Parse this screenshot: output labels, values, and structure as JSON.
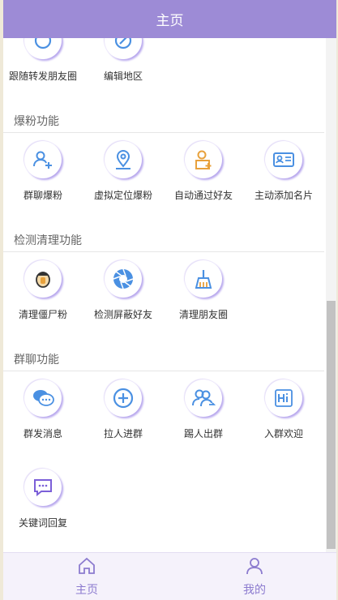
{
  "header": {
    "title": "主页"
  },
  "top_items": [
    {
      "label": "跟随转发朋友圈",
      "icon": "forward-icon"
    },
    {
      "label": "编辑地区",
      "icon": "edit-location-icon"
    }
  ],
  "sections": [
    {
      "title": "爆粉功能",
      "items": [
        {
          "label": "群聊爆粉",
          "icon": "group-add-icon"
        },
        {
          "label": "虚拟定位爆粉",
          "icon": "location-pin-icon"
        },
        {
          "label": "自动通过好友",
          "icon": "user-check-icon"
        },
        {
          "label": "主动添加名片",
          "icon": "card-icon"
        }
      ]
    },
    {
      "title": "检测清理功能",
      "items": [
        {
          "label": "清理僵尸粉",
          "icon": "zombie-icon"
        },
        {
          "label": "检测屏蔽好友",
          "icon": "shutter-icon"
        },
        {
          "label": "清理朋友圈",
          "icon": "broom-icon"
        }
      ]
    },
    {
      "title": "群聊功能",
      "items": [
        {
          "label": "群发消息",
          "icon": "chat-bubbles-icon"
        },
        {
          "label": "拉人进群",
          "icon": "plus-circle-icon"
        },
        {
          "label": "踢人出群",
          "icon": "user-remove-icon"
        },
        {
          "label": "入群欢迎",
          "icon": "hi-card-icon"
        },
        {
          "label": "关键词回复",
          "icon": "message-reply-icon"
        }
      ]
    }
  ],
  "bottom_nav": [
    {
      "label": "主页",
      "icon": "home-icon"
    },
    {
      "label": "我的",
      "icon": "user-icon"
    }
  ],
  "colors": {
    "header": "#9d8bd6",
    "accent": "#8c7bcf",
    "icon_blue": "#4a90e2",
    "icon_orange": "#e8a13c"
  }
}
